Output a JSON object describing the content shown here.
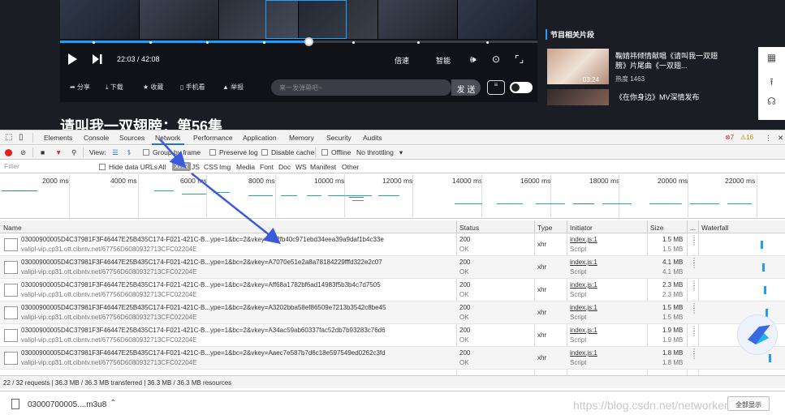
{
  "player": {
    "time": "22:03 / 42:08",
    "speed_label": "倍速",
    "quality_label": "智能",
    "progress_fraction": 0.52
  },
  "actions": {
    "share": "分享",
    "download": "下载",
    "favorite": "收藏",
    "mobile": "手机看",
    "report": "举报",
    "danmu_placeholder": "来一发弹幕吧~",
    "send": "发 送"
  },
  "page_title": "请叫我一双翅膀：第56集",
  "sidebar": {
    "heading": "节目相关片段",
    "cards": [
      {
        "title": "鞠婧祎倾情献唱《请叫我一双翅膀》片尾曲《一双翅...",
        "duration": "03:24",
        "heat": "热度 1463"
      },
      {
        "title": "《在你身边》MV深情发布",
        "duration": "",
        "heat": ""
      }
    ]
  },
  "devtools": {
    "tabs": [
      "Elements",
      "Console",
      "Sources",
      "Network",
      "Performance",
      "Application",
      "Memory",
      "Security",
      "Audits"
    ],
    "error_count": "7",
    "warning_count": "16",
    "toolbar": {
      "view_label": "View:",
      "group_by_frame": "Group by frame",
      "preserve_log": "Preserve log",
      "disable_cache": "Disable cache",
      "offline": "Offline",
      "throttling": "No throttling"
    },
    "filter": {
      "placeholder": "Filter",
      "hide_data_urls": "Hide data URLs",
      "types": [
        "All",
        "XHR",
        "JS",
        "CSS",
        "Img",
        "Media",
        "Font",
        "Doc",
        "WS",
        "Manifest",
        "Other"
      ]
    },
    "timeline_ticks": [
      "2000 ms",
      "4000 ms",
      "6000 ms",
      "8000 ms",
      "10000 ms",
      "12000 ms",
      "14000 ms",
      "16000 ms",
      "18000 ms",
      "20000 ms",
      "22000 ms"
    ],
    "columns": [
      "Name",
      "Status",
      "Type",
      "Initiator",
      "Size",
      "...",
      "Waterfall"
    ],
    "rows": [
      {
        "name": "03000900005D4C37981F3F46447E25B435C174-F021-421C-B...ype=1&bc=2&vkey=A92fb40c971ebd34eea39a9daf1b4c33e",
        "host": "valipl-vip.cp31.ott.cibntv.net/67756D6080932713CFC02204E",
        "status": "200",
        "status_text": "OK",
        "type": "xhr",
        "initiator": "index.js:1",
        "initiator_type": "Script",
        "size": "1.5 MB",
        "size2": "1.5 MB",
        "wf": 0.76
      },
      {
        "name": "03000900005D4C37981F3F46447E25B435C174-F021-421C-B...ype=1&bc=2&vkey=A7070e51e2a8a78184229fffd322e2c07",
        "host": "valipl-vip.cp31.ott.cibntv.net/67756D6080932713CFC02204E",
        "status": "200",
        "status_text": "OK",
        "type": "xhr",
        "initiator": "index.js:1",
        "initiator_type": "Script",
        "size": "4.1 MB",
        "size2": "4.1 MB",
        "wf": 0.78
      },
      {
        "name": "03000900005D4C37981F3F46447E25B435C174-F021-421C-B...ype=1&bc=2&vkey=Aff68a1782bf6ad14983f5b3b4c7d7505",
        "host": "valipl-vip.cp31.ott.cibntv.net/67756D6080932713CFC02204E",
        "status": "200",
        "status_text": "OK",
        "type": "xhr",
        "initiator": "index.js:1",
        "initiator_type": "Script",
        "size": "2.3 MB",
        "size2": "2.3 MB",
        "wf": 0.8
      },
      {
        "name": "03000900005D4C37981F3F46447E25B435C174-F021-421C-B...ype=1&bc=2&vkey=A3202bba58ef86509e7213b3542c8be45",
        "host": "valipl-vip.cp31.ott.cibntv.net/67756D6080932713CFC02204E",
        "status": "200",
        "status_text": "OK",
        "type": "xhr",
        "initiator": "index.js:1",
        "initiator_type": "Script",
        "size": "1.5 MB",
        "size2": "1.5 MB",
        "wf": 0.82
      },
      {
        "name": "03000900005D4C37981F3F46447E25B435C174-F021-421C-B...ype=1&bc=2&vkey=A34ac59ab60337fac52db7b93283c76d6",
        "host": "valipl-vip.cp31.ott.cibntv.net/67756D6080932713CFC02204E",
        "status": "200",
        "status_text": "OK",
        "type": "xhr",
        "initiator": "index.js:1",
        "initiator_type": "Script",
        "size": "1.9 MB",
        "size2": "1.9 MB",
        "wf": 0.84
      },
      {
        "name": "03000900005D4C37981F3F46447E25B435C174-F021-421C-B...ype=1&bc=2&vkey=Aaec7e587b7d6c18e597549ed0262c3fd",
        "host": "valipl-vip.cp31.ott.cibntv.net/67756D6080932713CFC02204E",
        "status": "200",
        "status_text": "OK",
        "type": "xhr",
        "initiator": "index.js:1",
        "initiator_type": "Script",
        "size": "1.8 MB",
        "size2": "1.8 MB",
        "wf": 0.86
      }
    ],
    "status_bar": "22 / 32 requests | 36.3 MB / 36.3 MB transferred | 36.3 MB / 36.3 MB resources"
  },
  "downloads": {
    "file_name": "03000700005....m3u8",
    "watermark": "https://blog.csdn.net/networken",
    "show_all": "全部显示"
  },
  "colors": {
    "accent": "#1e9cff",
    "error": "#d93025",
    "record": "#e0201a"
  }
}
